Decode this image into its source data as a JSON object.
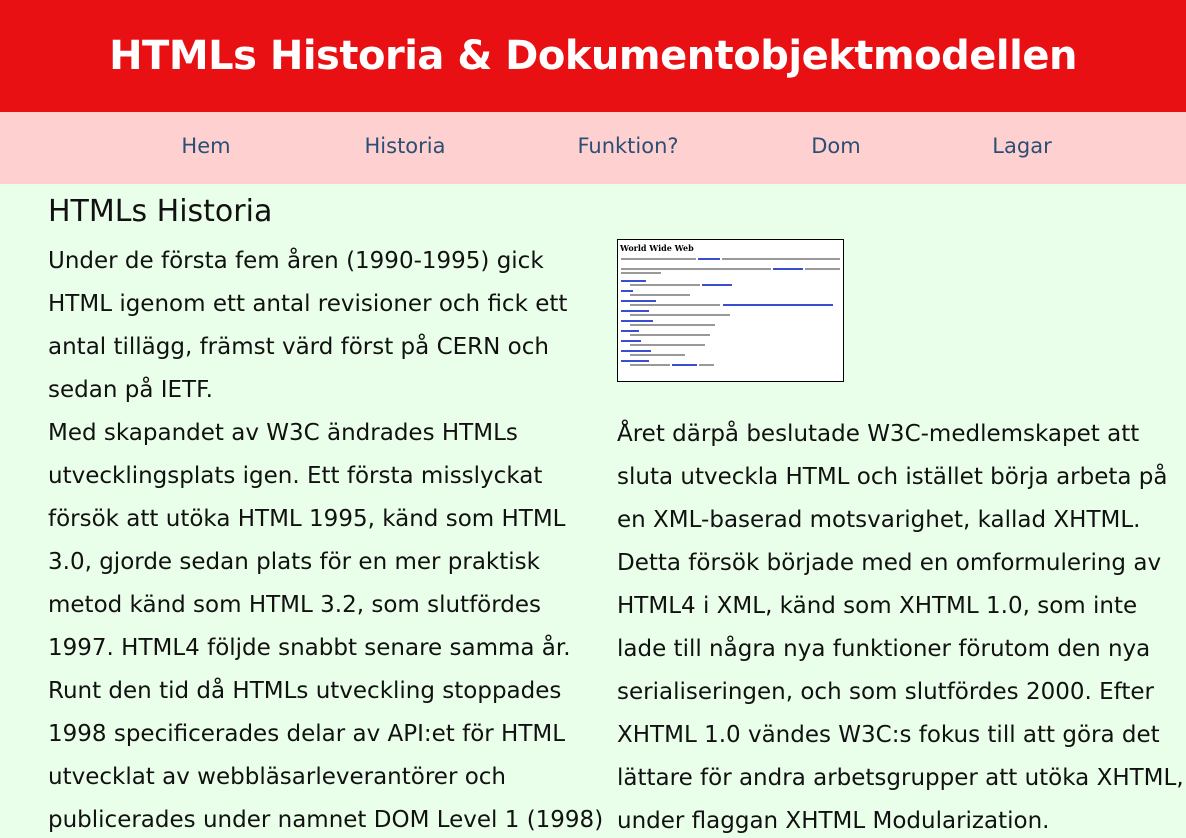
{
  "header": {
    "title": "HTMLs Historia & Dokumentobjektmodellen"
  },
  "nav": {
    "items": [
      {
        "label": "Hem"
      },
      {
        "label": "Historia"
      },
      {
        "label": "Funktion?"
      },
      {
        "label": "Dom"
      },
      {
        "label": "Lagar"
      }
    ]
  },
  "main": {
    "title": "HTMLs Historia",
    "paragraph1": "Under de första fem åren (1990-1995) gick HTML igenom ett antal revisioner och fick ett antal tillägg, främst värd först på CERN och sedan på IETF.",
    "paragraph2": "Med skapandet av W3C ändrades HTMLs utvecklingsplats igen. Ett första misslyckat försök att utöka HTML 1995, känd som HTML 3.0, gjorde sedan plats för en mer praktisk metod känd som HTML 3.2, som slutfördes 1997. HTML4 följde snabbt senare samma år. Runt den tid då HTMLs utveckling stoppades 1998 specificerades delar av API:et för HTML utvecklat av webbläsarleverantörer och publicerades under namnet DOM Level 1 (1998)",
    "paragraph3": "Året därpå beslutade W3C-medlemskapet att sluta utveckla HTML och istället börja arbeta på en XML-baserad motsvarighet, kallad XHTML. Detta försök började med en omformulering av HTML4 i XML, känd som XHTML 1.0, som inte lade till några nya funktioner förutom den nya serialiseringen, och som slutfördes 2000. Efter XHTML 1.0 vändes W3C:s fokus till att göra det lättare för andra arbetsgrupper att utöka XHTML, under flaggan XHTML Modularization."
  },
  "image": {
    "title": "World Wide Web"
  },
  "colors": {
    "header": "#e81013",
    "nav": "#ffd0d0",
    "nav_link": "#2b4f74",
    "background": "#eaffea"
  }
}
